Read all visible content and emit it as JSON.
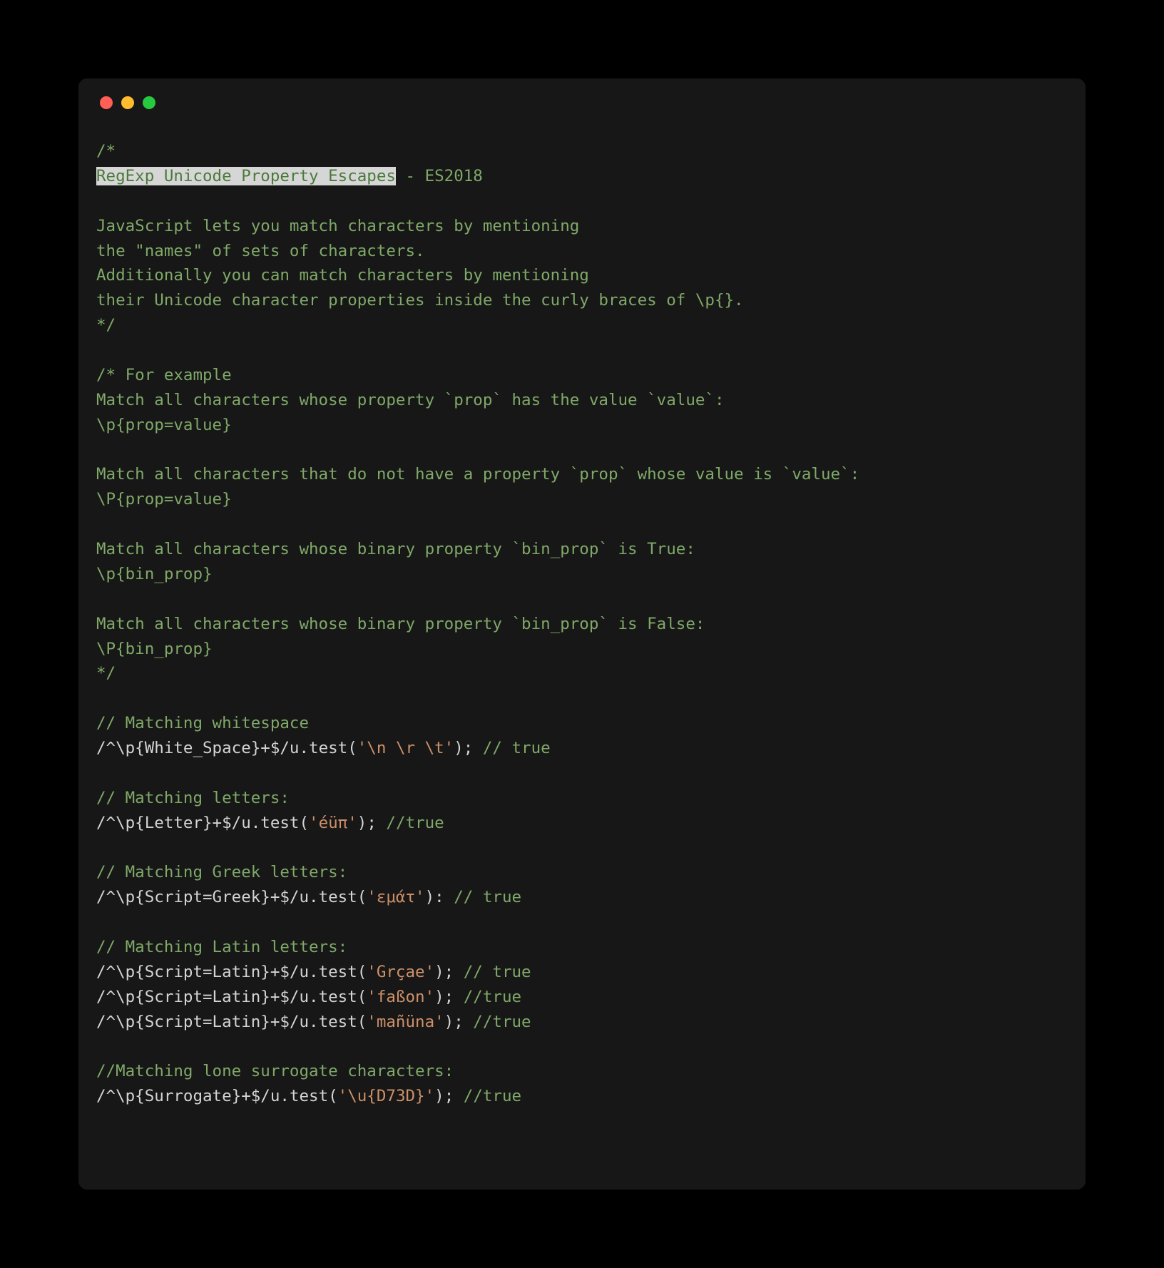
{
  "code": {
    "line1": "/*",
    "line2_highlight": "RegExp Unicode Property Escapes",
    "line2_rest": " - ES2018",
    "line3": "",
    "line4": "JavaScript lets you match characters by mentioning",
    "line5": "the \"names\" of sets of characters.",
    "line6": "Additionally you can match characters by mentioning",
    "line7": "their Unicode character properties inside the curly braces of \\p{}.",
    "line8": "*/",
    "line9": "",
    "line10": "/* For example",
    "line11": "Match all characters whose property `prop` has the value `value`:",
    "line12": "\\p{prop=value}",
    "line13": "",
    "line14": "Match all characters that do not have a property `prop` whose value is `value`:",
    "line15": "\\P{prop=value}",
    "line16": "",
    "line17": "Match all characters whose binary property `bin_prop` is True:",
    "line18": "\\p{bin_prop}",
    "line19": "",
    "line20": "Match all characters whose binary property `bin_prop` is False:",
    "line21": "\\P{bin_prop}",
    "line22": "*/",
    "line23": "",
    "line24_comment": "// Matching whitespace",
    "line25_regex": "/^\\p{White_Space}+$/u",
    "line25_dot": ".",
    "line25_method": "test",
    "line25_paren_open": "(",
    "line25_string": "'\\n \\r \\t'",
    "line25_paren_close": ")",
    "line25_semi": ";",
    "line25_comment": " // true",
    "line26": "",
    "line27_comment": "// Matching letters:",
    "line28_regex": "/^\\p{Letter}+$/u",
    "line28_dot": ".",
    "line28_method": "test",
    "line28_paren_open": "(",
    "line28_string": "'éüπ'",
    "line28_paren_close": ")",
    "line28_semi": ";",
    "line28_comment": " //true",
    "line29": "",
    "line30_comment": "// Matching Greek letters:",
    "line31_regex": "/^\\p{Script=Greek}+$/u",
    "line31_dot": ".",
    "line31_method": "test",
    "line31_paren_open": "(",
    "line31_string": "'εμάτ'",
    "line31_paren_close": ")",
    "line31_colon": ":",
    "line31_comment": " // true",
    "line32": "",
    "line33_comment": "// Matching Latin letters:",
    "line34_regex": "/^\\p{Script=Latin}+$/u",
    "line34_dot": ".",
    "line34_method": "test",
    "line34_paren_open": "(",
    "line34_string": "'Grçae'",
    "line34_paren_close": ")",
    "line34_semi": ";",
    "line34_comment": " // true",
    "line35_regex": "/^\\p{Script=Latin}+$/u",
    "line35_dot": ".",
    "line35_method": "test",
    "line35_paren_open": "(",
    "line35_string": "'faßon'",
    "line35_paren_close": ")",
    "line35_semi": ";",
    "line35_comment": " //true",
    "line36_regex": "/^\\p{Script=Latin}+$/u",
    "line36_dot": ".",
    "line36_method": "test",
    "line36_paren_open": "(",
    "line36_string": "'mañüna'",
    "line36_paren_close": ")",
    "line36_semi": ";",
    "line36_comment": " //true",
    "line37": "",
    "line38_comment": "//Matching lone surrogate characters:",
    "line39_regex": "/^\\p{Surrogate}+$/u",
    "line39_dot": ".",
    "line39_method": "test",
    "line39_paren_open": "(",
    "line39_string": "'\\u{D73D}'",
    "line39_paren_close": ")",
    "line39_semi": ";",
    "line39_comment": " //true"
  }
}
